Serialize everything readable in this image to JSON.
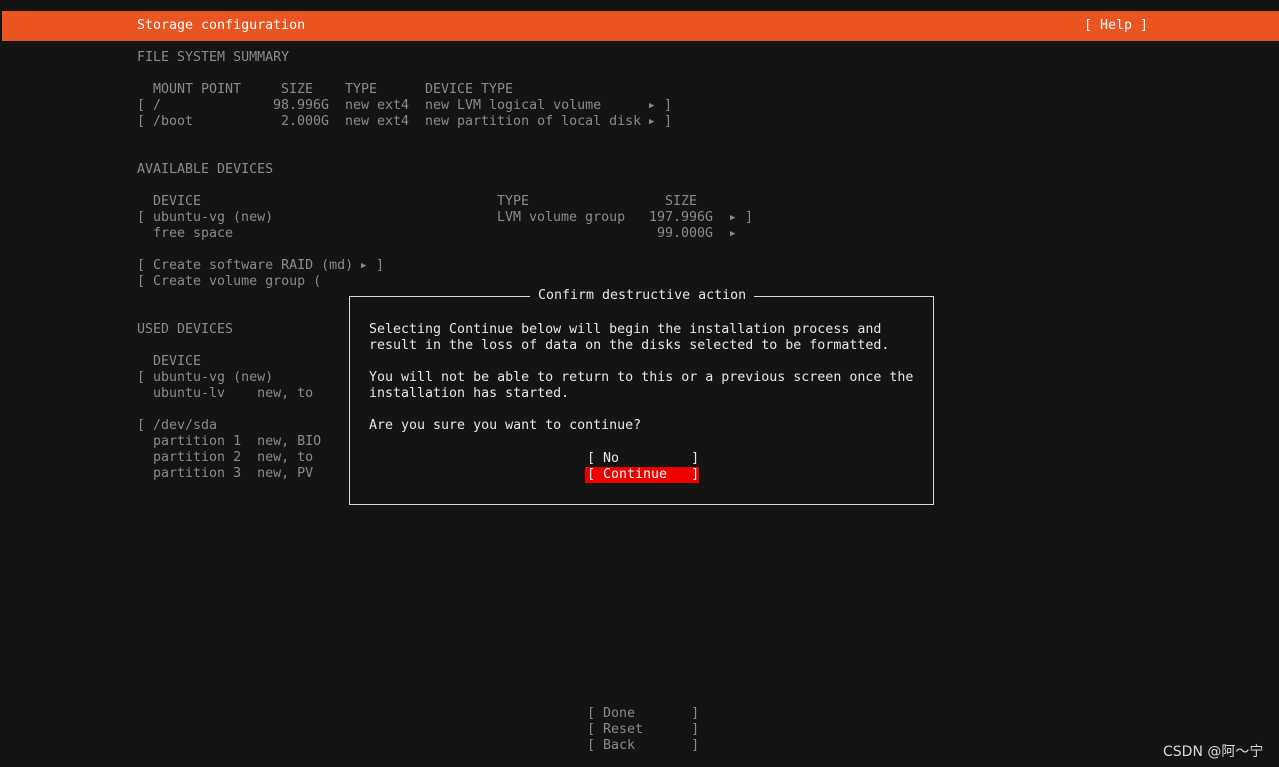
{
  "header": {
    "title": "Storage configuration",
    "help_label": "[ Help ]"
  },
  "fs_summary": {
    "heading": "FILE SYSTEM SUMMARY",
    "columns": [
      "MOUNT POINT",
      "SIZE",
      "TYPE",
      "DEVICE TYPE"
    ],
    "rows": [
      {
        "open": "[",
        "mount": "/",
        "size": "98.996G",
        "type": "new ext4",
        "device_type": "new LVM logical volume",
        "close": "]"
      },
      {
        "open": "[",
        "mount": "/boot",
        "size": "2.000G",
        "type": "new ext4",
        "device_type": "new partition of local disk",
        "close": "]"
      }
    ]
  },
  "available": {
    "heading": "AVAILABLE DEVICES",
    "columns": [
      "DEVICE",
      "TYPE",
      "SIZE"
    ],
    "rows": [
      {
        "open": "[",
        "device": "ubuntu-vg (new)",
        "type": "LVM volume group",
        "size": "197.996G",
        "close": "]"
      },
      {
        "device": "free space",
        "size": "99.000G"
      }
    ],
    "actions": [
      "[ Create software RAID (md) ",
      "[ Create volume group ("
    ],
    "raid_close": "]"
  },
  "used": {
    "heading": "USED DEVICES",
    "column": "DEVICE",
    "rows": [
      "[ ubuntu-vg (new)",
      "  ubuntu-lv    new, to",
      "",
      "[ /dev/sda",
      "  partition 1  new, BIO",
      "  partition 2  new, to",
      "  partition 3  new, PV"
    ]
  },
  "dialog": {
    "title": "Confirm destructive action",
    "line1": "Selecting Continue below will begin the installation process and",
    "line2": "result in the loss of data on the disks selected to be formatted.",
    "line3": "You will not be able to return to this or a previous screen once the",
    "line4": "installation has started.",
    "line5": "Are you sure you want to continue?",
    "no_label": "[ No         ]",
    "continue_label": "[ Continue   ]"
  },
  "footer": {
    "done": "[ Done       ]",
    "reset": "[ Reset      ]",
    "back": "[ Back       ]"
  },
  "watermark": "CSDN @阿～宁",
  "colors": {
    "accent": "#e95420",
    "danger": "#ee0000",
    "background": "#141414"
  }
}
